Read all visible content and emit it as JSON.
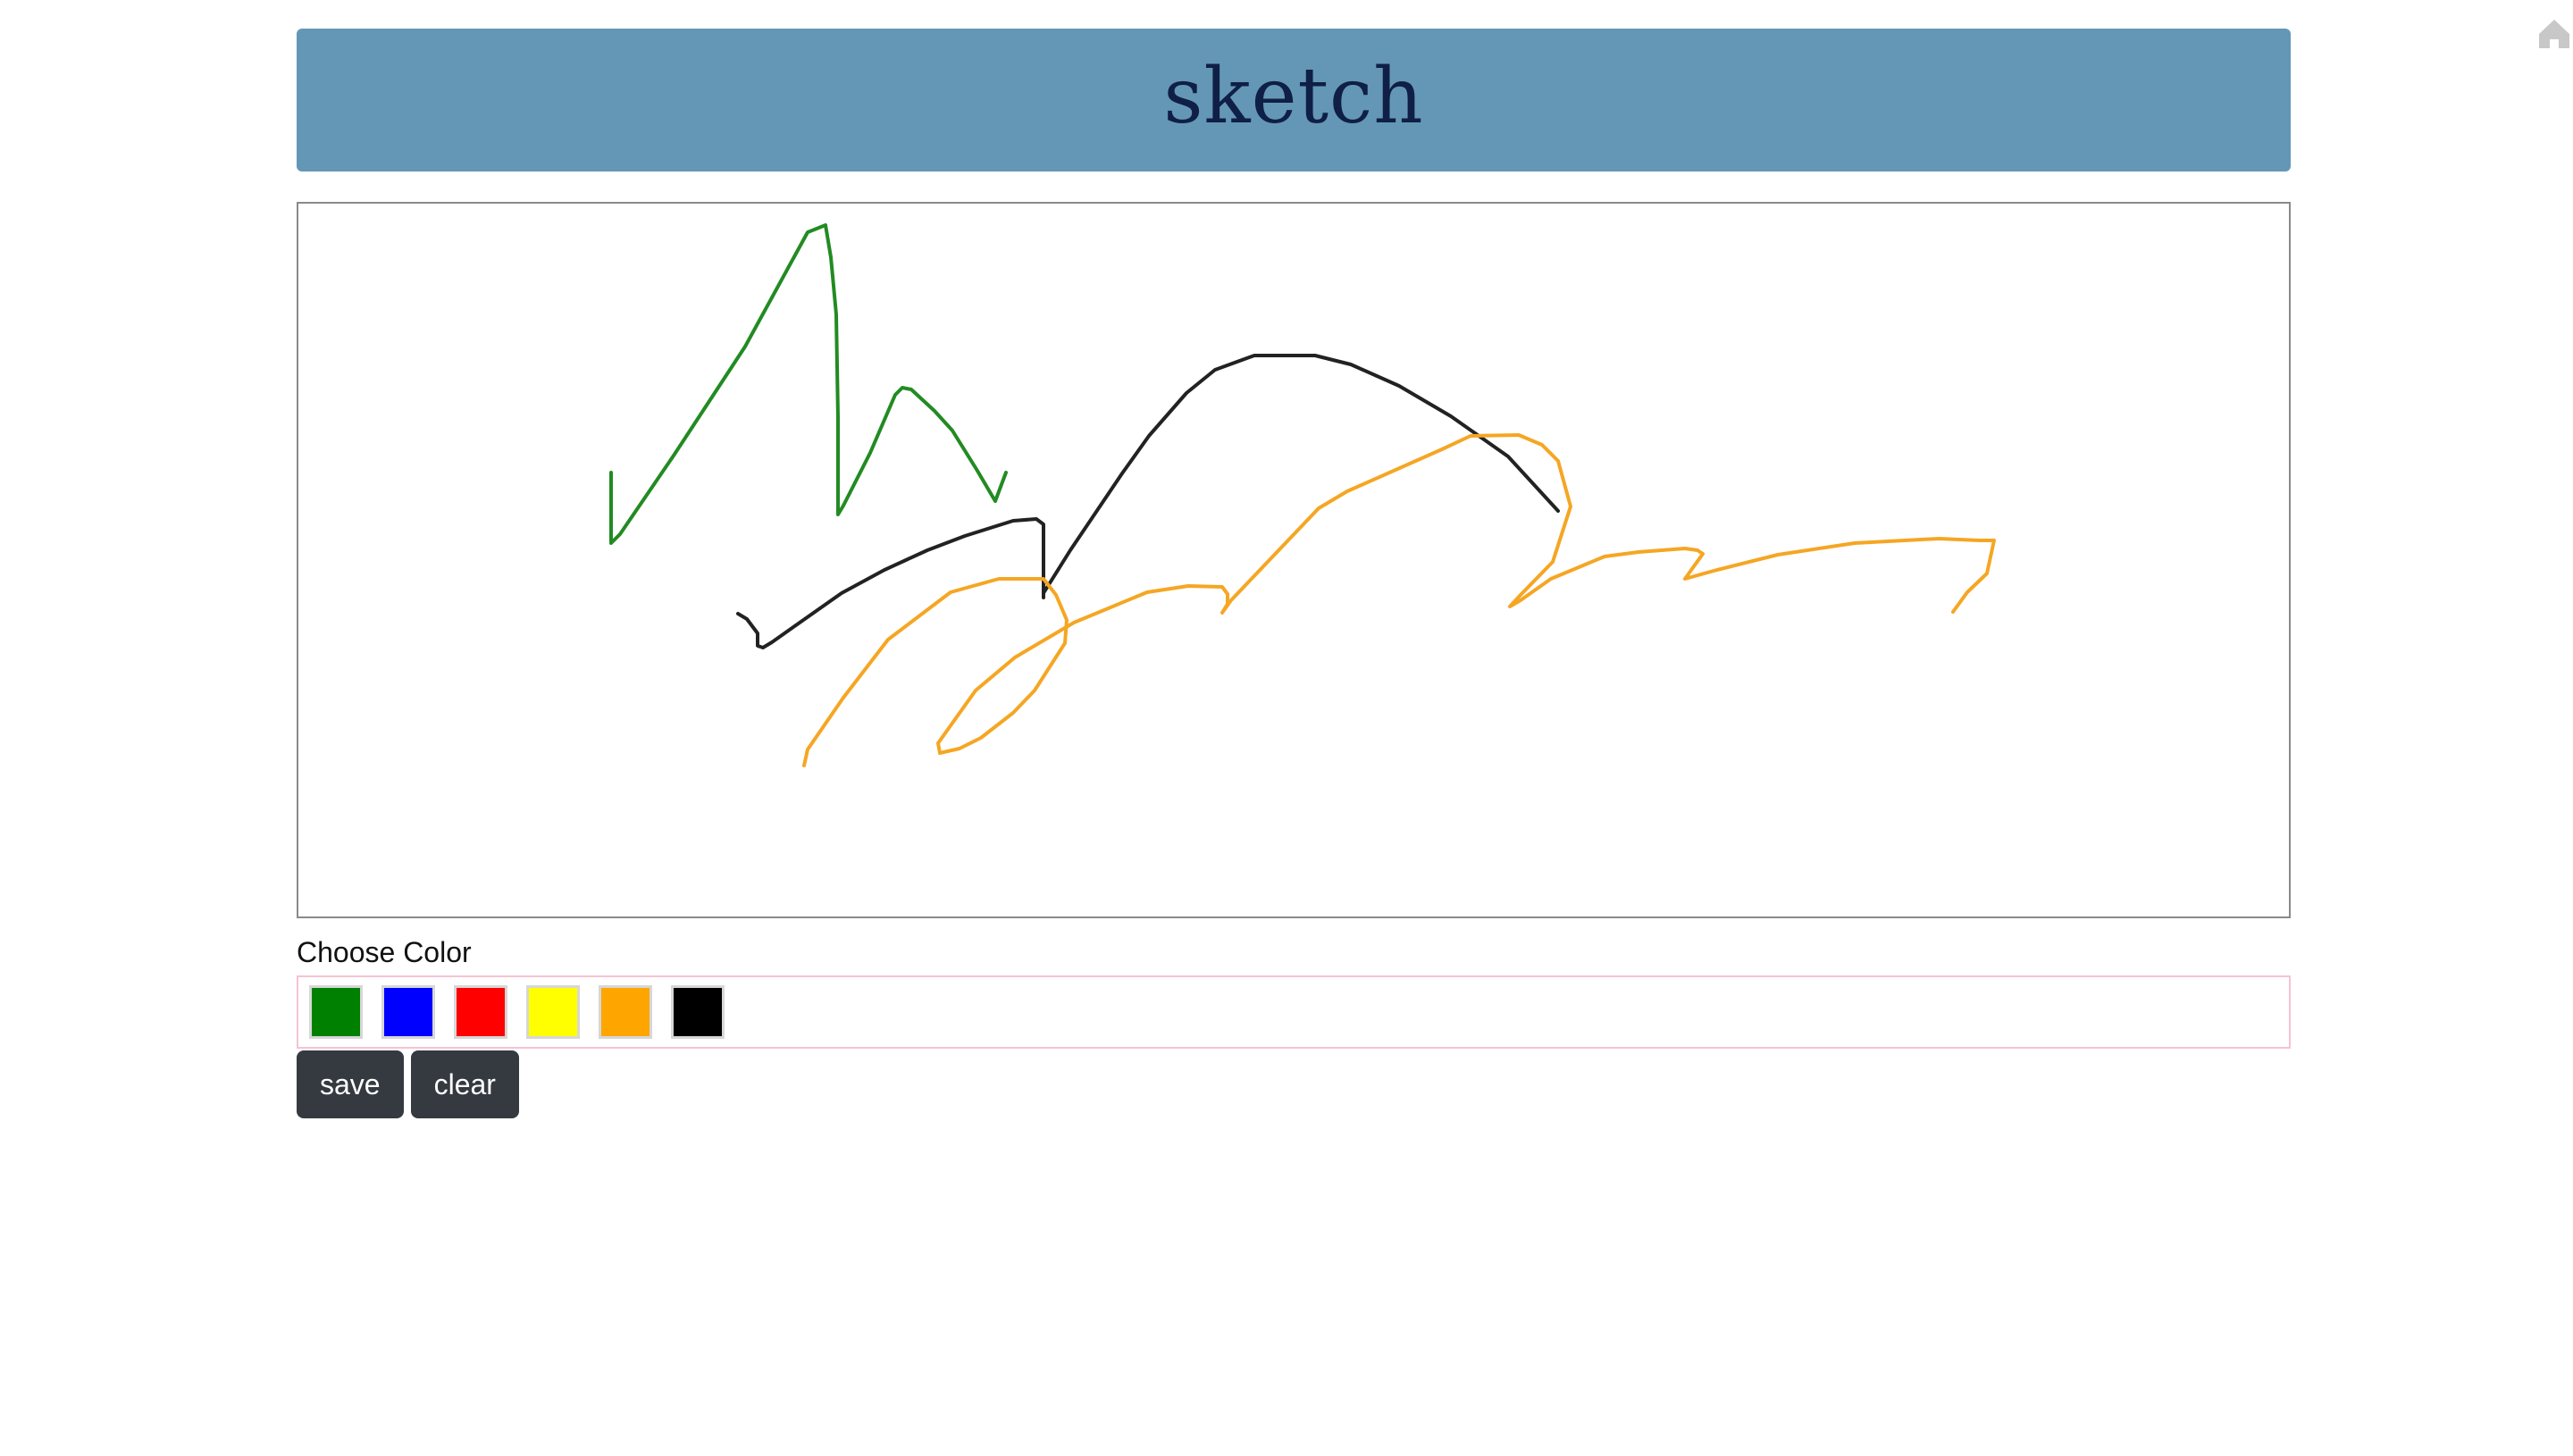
{
  "header": {
    "title": "sketch"
  },
  "nav": {
    "home_icon": "home-icon"
  },
  "canvas": {
    "strokes": [
      {
        "color": "#228b22",
        "points": "[[350,301],[350,380],[360,370],[420,282],[500,160],[570,32],[590,24],[596,60],[602,124],[604,240],[604,348],[610,338],[640,279],[668,214],[676,206],[686,208],[712,232],[732,254],[760,299],[780,333],[792,301]]"
      },
      {
        "color": "#222222",
        "points": "[[492,459],[502,465],[514,481],[514,495],[520,497],[530,491],[554,474],[608,436],[656,410],[704,388],[746,372],[800,355],[826,353],[834,359],[834,436],[834,436],[834,441],[834,436],[864,388],[922,302],[952,260],[994,212],[1026,186],[1070,170],[1138,170],[1178,180],[1232,204],[1290,238],[1354,283],[1410,344]]"
      },
      {
        "color": "#f5a623",
        "points": "[[566,629],[570,611],[610,553],[660,488],[730,435],[784,420],[834,420],[848,438],[860,466],[858,492],[824,545],[800,570],[764,598],[740,610],[718,615],[716,604],[758,545],[802,508],[868,469],[950,435],[996,428],[1034,429],[1040,437],[1040,448],[1034,458],[1044,444],[1142,341],[1174,322],[1280,275],[1312,260],[1366,259],[1392,270],[1410,288],[1424,339],[1424,339],[1404,401],[1368,438],[1356,451],[1368,444],[1402,420],[1462,395],[1500,390],[1552,386],[1566,388],[1572,392],[1552,420],[1588,410],[1656,393],[1742,380],[1836,375],[1882,377],[1898,377],[1890,414],[1868,435],[1852,457]]"
      }
    ]
  },
  "palette": {
    "label": "Choose Color",
    "colors": [
      {
        "name": "green",
        "hex": "#008000"
      },
      {
        "name": "blue",
        "hex": "#0000ff"
      },
      {
        "name": "red",
        "hex": "#ff0000"
      },
      {
        "name": "yellow",
        "hex": "#ffff00"
      },
      {
        "name": "orange",
        "hex": "#ffa500"
      },
      {
        "name": "black",
        "hex": "#000000"
      }
    ]
  },
  "actions": {
    "save_label": "save",
    "clear_label": "clear"
  }
}
